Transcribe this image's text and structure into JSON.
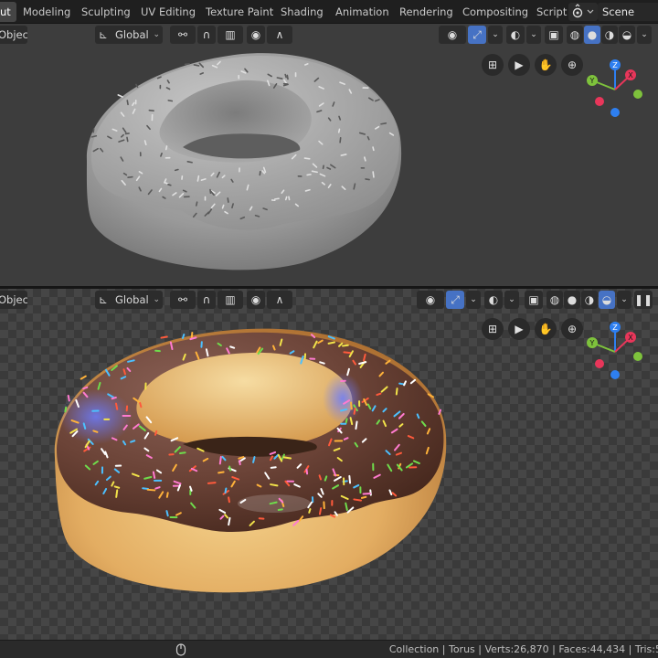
{
  "workspace_tabs": [
    "ut",
    "Modeling",
    "Sculpting",
    "UV Editing",
    "Texture Paint",
    "Shading",
    "Animation",
    "Rendering",
    "Compositing",
    "Script"
  ],
  "scene": {
    "name": "Scene"
  },
  "viewport_top": {
    "mode": "Object",
    "transform_orientation": "Global",
    "shading": "solid"
  },
  "viewport_bottom": {
    "mode": "Object",
    "transform_orientation": "Global",
    "shading": "rendered"
  },
  "gizmo": {
    "z": "Z",
    "y": "Y",
    "x": "X"
  },
  "status": {
    "text": "Collection | Torus | Verts:26,870 | Faces:44,434 | Tris:5"
  },
  "colors": {
    "accent": "#4672c4",
    "x_axis": "#e8365a",
    "y_axis": "#7ec23c",
    "z_axis": "#2e7ff0"
  }
}
